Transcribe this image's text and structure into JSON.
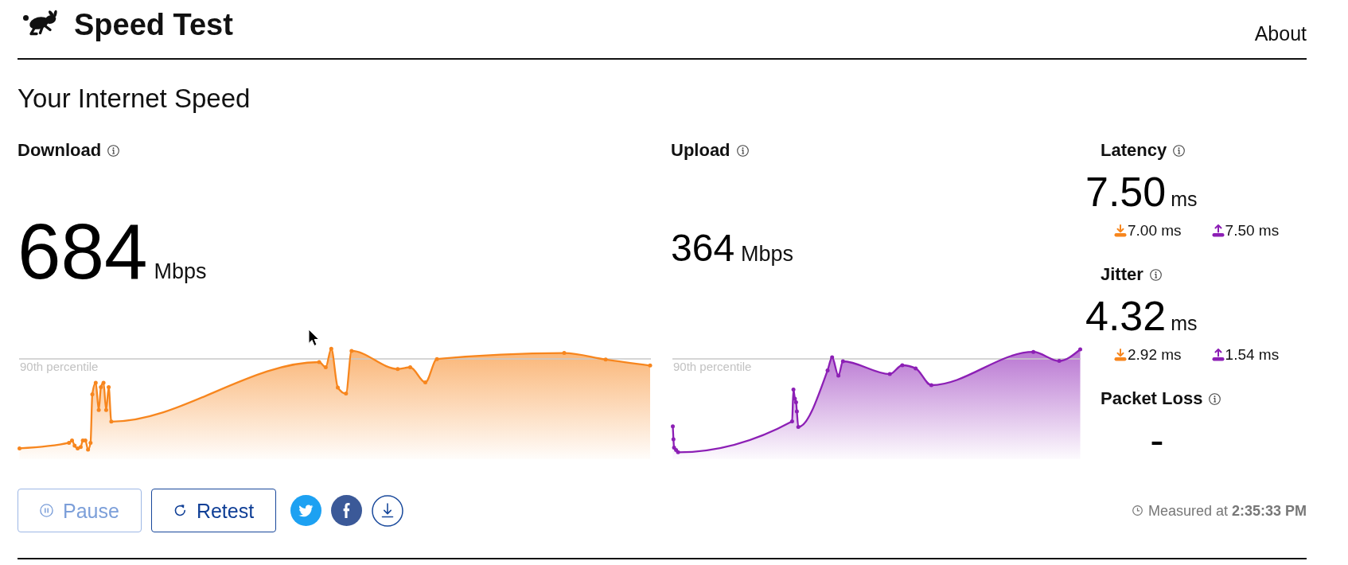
{
  "header": {
    "title": "Speed Test",
    "links": [
      {
        "label": "About"
      }
    ]
  },
  "heading": "Your Internet Speed",
  "results": [
    {
      "kind": "download",
      "label": "Download",
      "value": "684",
      "unit": "Mbps",
      "reference_label": "90th percentile"
    },
    {
      "kind": "upload",
      "label": "Upload",
      "value": "364",
      "unit": "Mbps",
      "reference_label": "90th percentile"
    }
  ],
  "stats": [
    {
      "label": "Latency",
      "value": "7.50",
      "unit": "ms",
      "download": "7.00 ms",
      "upload": "7.50 ms"
    },
    {
      "label": "Jitter",
      "value": "4.32",
      "unit": "ms",
      "download": "2.92 ms",
      "upload": "1.54 ms"
    },
    {
      "label": "Packet Loss",
      "value": "-"
    }
  ],
  "controls": [
    {
      "kind": "pause",
      "label": "Pause",
      "disabled": true
    },
    {
      "kind": "retest",
      "label": "Retest",
      "disabled": false
    }
  ],
  "share": [
    {
      "kind": "twitter"
    },
    {
      "kind": "facebook"
    },
    {
      "kind": "save"
    }
  ],
  "measured": "Measured at **2:35:33 PM**"
}
